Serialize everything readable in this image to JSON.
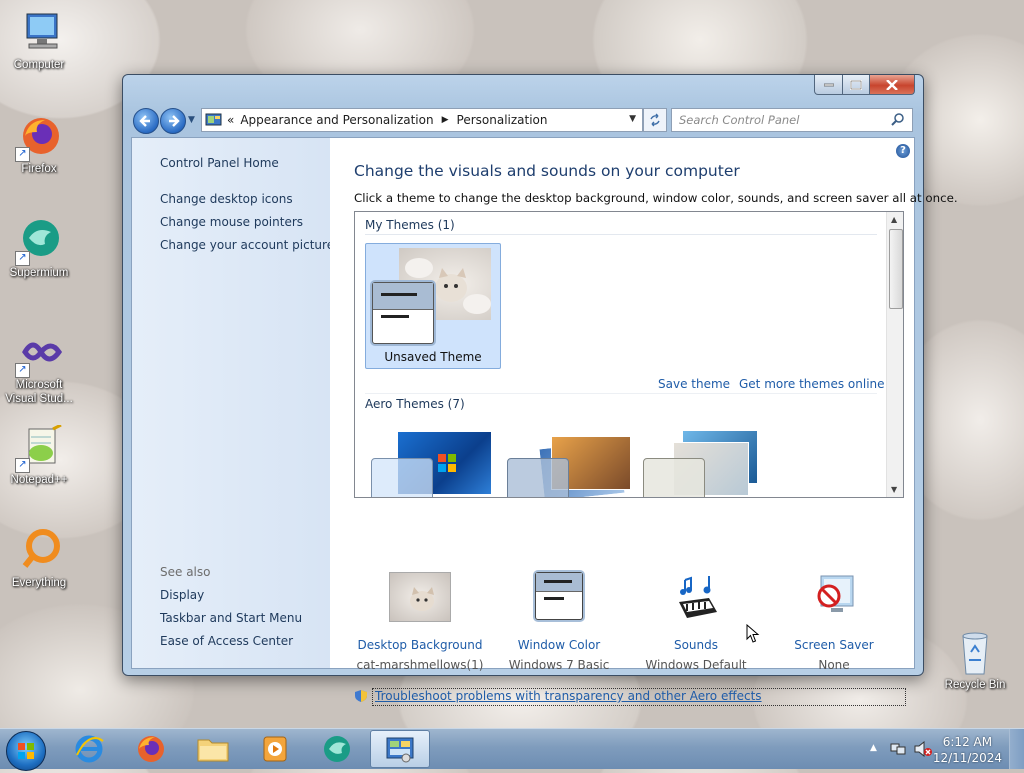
{
  "desktop": {
    "icons": [
      {
        "label": "Computer",
        "icon": "computer-icon"
      },
      {
        "label": "Firefox",
        "icon": "firefox-icon"
      },
      {
        "label": "Supermium",
        "icon": "supermium-icon"
      },
      {
        "label": "Microsoft Visual Stud...",
        "icon": "visual-studio-icon"
      },
      {
        "label": "Notepad++",
        "icon": "notepadpp-icon"
      },
      {
        "label": "Everything",
        "icon": "everything-icon"
      },
      {
        "label": "Recycle Bin",
        "icon": "recycle-bin-icon"
      }
    ]
  },
  "window": {
    "breadcrumb": {
      "overflow": "«",
      "items": [
        "Appearance and Personalization",
        "Personalization"
      ]
    },
    "search_placeholder": "Search Control Panel",
    "left_pane": {
      "home": "Control Panel Home",
      "links": [
        "Change desktop icons",
        "Change mouse pointers",
        "Change your account picture"
      ],
      "see_also_header": "See also",
      "see_also": [
        "Display",
        "Taskbar and Start Menu",
        "Ease of Access Center"
      ]
    },
    "main": {
      "title": "Change the visuals and sounds on your computer",
      "subtitle": "Click a theme to change the desktop background, window color, sounds, and screen saver all at once.",
      "my_themes_header": "My Themes (1)",
      "selected_theme": "Unsaved Theme",
      "save_theme": "Save theme",
      "get_more_themes": "Get more themes online",
      "aero_themes_header": "Aero Themes (7)",
      "bottom_items": [
        {
          "link": "Desktop Background",
          "value": "cat-marshmellows(1)"
        },
        {
          "link": "Window Color",
          "value": "Windows 7 Basic"
        },
        {
          "link": "Sounds",
          "value": "Windows Default"
        },
        {
          "link": "Screen Saver",
          "value": "None"
        }
      ],
      "troubleshoot": "Troubleshoot problems with transparency and other Aero effects"
    }
  },
  "taskbar": {
    "time": "6:12 AM",
    "date": "12/11/2024"
  },
  "colors": {
    "link": "#1f5ca8",
    "title": "#1e3e6e",
    "selection": "#cfe3fc"
  }
}
